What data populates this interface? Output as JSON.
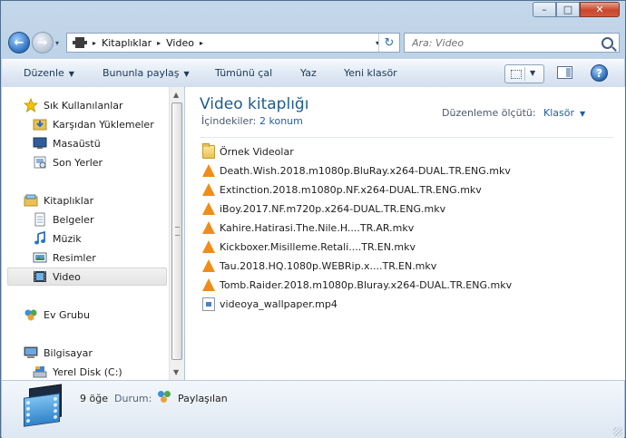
{
  "window": {
    "controls": {
      "minimize": "–",
      "maximize": "□",
      "close": "✕"
    }
  },
  "address_bar": {
    "crumbs": [
      "Kitaplıklar",
      "Video"
    ],
    "crumb_separator": "▸",
    "dropdown_glyph": "▾",
    "refresh_glyph": "↻"
  },
  "search": {
    "placeholder": "Ara: Video"
  },
  "toolbar": {
    "organize": "Düzenle",
    "share_with": "Bununla paylaş",
    "play_all": "Tümünü çal",
    "burn": "Yaz",
    "new_folder": "Yeni klasör",
    "help": "?"
  },
  "nav": {
    "favorites": {
      "label": "Sık Kullanılanlar",
      "items": [
        "Karşıdan Yüklemeler",
        "Masaüstü",
        "Son Yerler"
      ]
    },
    "libraries": {
      "label": "Kitaplıklar",
      "items": [
        "Belgeler",
        "Müzik",
        "Resimler",
        "Video"
      ],
      "selected": "Video"
    },
    "homegroup": {
      "label": "Ev Grubu"
    },
    "computer": {
      "label": "Bilgisayar",
      "items": [
        "Yerel Disk (C:)"
      ]
    }
  },
  "library": {
    "title": "Video kitaplığı",
    "includes_label": "İçindekiler:",
    "includes_link": "2 konum",
    "arrange_label": "Düzenleme ölçütü:",
    "arrange_value": "Klasör"
  },
  "files": [
    {
      "name": "Örnek Videolar",
      "icon": "folder-icon"
    },
    {
      "name": "Death.Wish.2018.m1080p.BluRay.x264-DUAL.TR.ENG.mkv",
      "icon": "vlc-icon"
    },
    {
      "name": "Extinction.2018.m1080p.NF.x264-DUAL.TR.ENG.mkv",
      "icon": "vlc-icon"
    },
    {
      "name": "iBoy.2017.NF.m720p.x264-DUAL.TR.ENG.mkv",
      "icon": "vlc-icon"
    },
    {
      "name": "Kahire.Hatirasi.The.Nile.H....TR.AR.mkv",
      "icon": "vlc-icon"
    },
    {
      "name": "Kickboxer.Misilleme.Retali....TR.EN.mkv",
      "icon": "vlc-icon"
    },
    {
      "name": "Tau.2018.HQ.1080p.WEBRip.x....TR.EN.mkv",
      "icon": "vlc-icon"
    },
    {
      "name": "Tomb.Raider.2018.m1080p.Bluray.x264-DUAL.TR.ENG.mkv",
      "icon": "vlc-icon"
    },
    {
      "name": "videoya_wallpaper.mp4",
      "icon": "video-file-icon"
    }
  ],
  "status": {
    "count": "9 öğe",
    "state_label": "Durum:",
    "state_value": "Paylaşılan"
  },
  "colors": {
    "title_blue": "#1e5b8f",
    "link_blue": "#1f5fa6",
    "vlc_orange": "#f08c1a",
    "frame": "#b2c9e2"
  }
}
